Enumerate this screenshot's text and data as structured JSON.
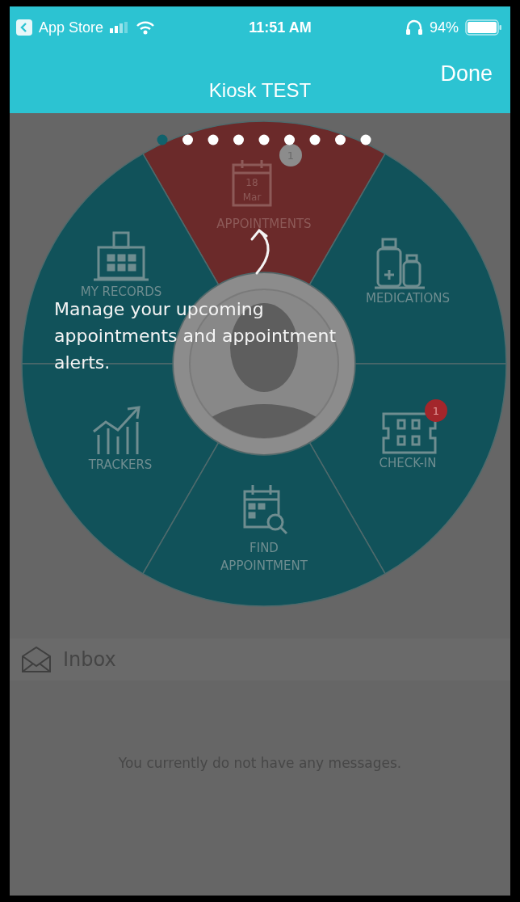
{
  "status_bar": {
    "back_app": "App Store",
    "time": "11:51 AM",
    "battery": "94%"
  },
  "nav_bar": {
    "title": "Kiosk TEST",
    "done": "Done"
  },
  "page_dots": [
    {
      "selected": true
    },
    {
      "selected": false
    },
    {
      "selected": false
    },
    {
      "selected": false
    },
    {
      "selected": false
    },
    {
      "selected": false
    },
    {
      "selected": false
    },
    {
      "selected": false
    },
    {
      "selected": false
    }
  ],
  "menu_segments": [
    {
      "kind": "appointments",
      "label_lines": [
        "APPOINTMENTS"
      ],
      "selected": true,
      "date_day": "18",
      "date_month": "Mar",
      "badge": {
        "count": "1",
        "color": "#8c8c8c"
      }
    },
    {
      "kind": "records",
      "label_lines": [
        "MY RECORDS"
      ],
      "selected": false
    },
    {
      "kind": "medications",
      "label_lines": [
        "MEDICATIONS"
      ],
      "selected": false
    },
    {
      "kind": "trackers",
      "label_lines": [
        "TRACKERS"
      ],
      "selected": false
    },
    {
      "kind": "checkin",
      "label_lines": [
        "CHECK-IN"
      ],
      "selected": false,
      "badge": {
        "count": "1",
        "color": "#a3262b"
      }
    },
    {
      "kind": "find",
      "label_lines": [
        "FIND",
        "APPOINTMENT"
      ],
      "selected": false
    }
  ],
  "coach_tip": "Manage your upcoming appointments and appointment alerts.",
  "inbox": {
    "title": "Inbox",
    "empty_message": "You currently do not have any messages."
  }
}
